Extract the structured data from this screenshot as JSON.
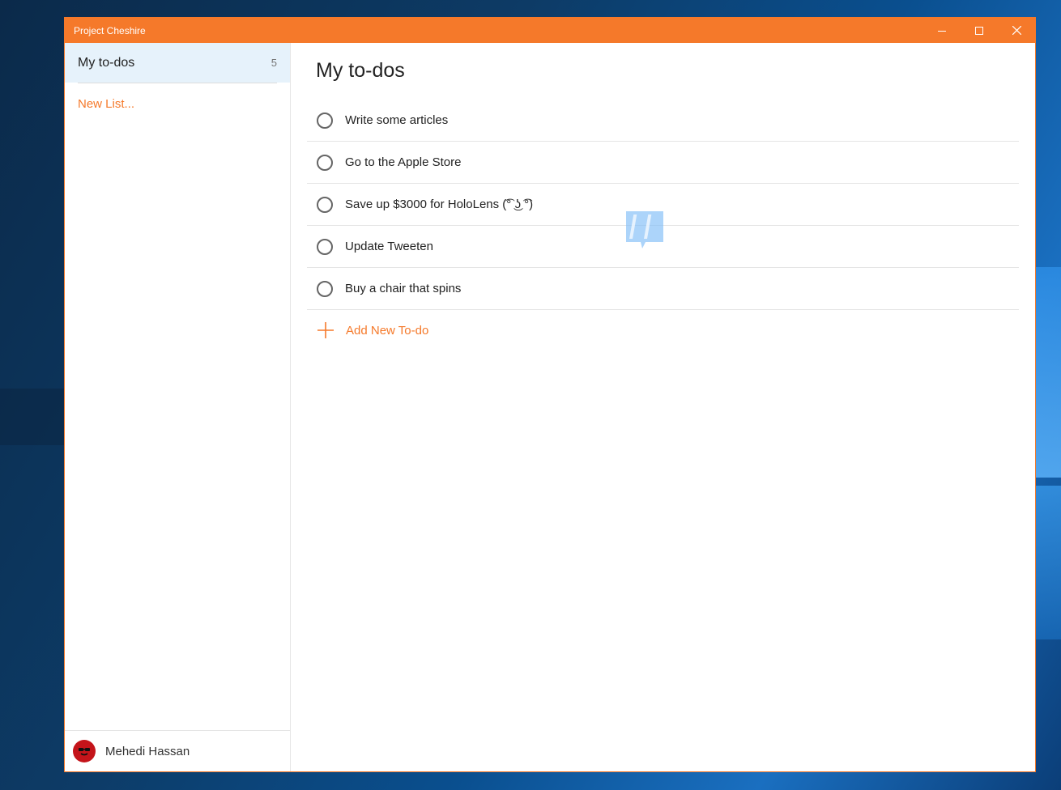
{
  "window": {
    "title": "Project Cheshire",
    "accent": "#f5792a"
  },
  "sidebar": {
    "lists": [
      {
        "name": "My to-dos",
        "count": "5"
      }
    ],
    "new_list_label": "New List...",
    "user": {
      "name": "Mehedi Hassan"
    }
  },
  "main": {
    "title": "My to-dos",
    "todos": [
      {
        "text": "Write some articles"
      },
      {
        "text": "Go to the Apple Store"
      },
      {
        "text": "Save up $3000 for HoloLens (͡° ͜ʖ ͡°)"
      },
      {
        "text": "Update Tweeten"
      },
      {
        "text": "Buy a chair that spins"
      }
    ],
    "add_label": "Add New To-do"
  }
}
